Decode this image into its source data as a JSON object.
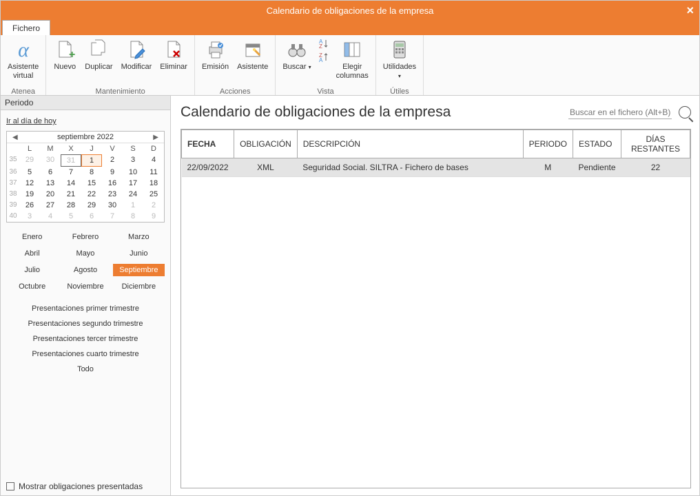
{
  "window": {
    "title": "Calendario de obligaciones de la empresa"
  },
  "tabs": {
    "fichero": "Fichero"
  },
  "ribbon": {
    "atenea": {
      "label": "Asistente\nvirtual",
      "group": "Atenea"
    },
    "mantenimiento": {
      "group": "Mantenimiento",
      "nuevo": "Nuevo",
      "duplicar": "Duplicar",
      "modificar": "Modificar",
      "eliminar": "Eliminar"
    },
    "acciones": {
      "group": "Acciones",
      "emision": "Emisión",
      "asistente": "Asistente"
    },
    "vista": {
      "group": "Vista",
      "buscar": "Buscar",
      "elegir": "Elegir\ncolumnas"
    },
    "utilidades": {
      "group": "Útiles",
      "util": "Utilidades"
    }
  },
  "sidebar": {
    "header": "Periodo",
    "today_link": "Ir al día de hoy",
    "cal_title": "septiembre  2022",
    "dow": [
      "L",
      "M",
      "X",
      "J",
      "V",
      "S",
      "D"
    ],
    "weeks": [
      {
        "wk": "35",
        "days": [
          {
            "d": "29",
            "o": true
          },
          {
            "d": "30",
            "o": true
          },
          {
            "d": "31",
            "o": true,
            "sel": true
          },
          {
            "d": "1",
            "today": true
          },
          {
            "d": "2"
          },
          {
            "d": "3"
          },
          {
            "d": "4"
          }
        ]
      },
      {
        "wk": "36",
        "days": [
          {
            "d": "5"
          },
          {
            "d": "6"
          },
          {
            "d": "7"
          },
          {
            "d": "8"
          },
          {
            "d": "9"
          },
          {
            "d": "10"
          },
          {
            "d": "11"
          }
        ]
      },
      {
        "wk": "37",
        "days": [
          {
            "d": "12"
          },
          {
            "d": "13"
          },
          {
            "d": "14"
          },
          {
            "d": "15"
          },
          {
            "d": "16"
          },
          {
            "d": "17"
          },
          {
            "d": "18"
          }
        ]
      },
      {
        "wk": "38",
        "days": [
          {
            "d": "19"
          },
          {
            "d": "20"
          },
          {
            "d": "21"
          },
          {
            "d": "22"
          },
          {
            "d": "23"
          },
          {
            "d": "24"
          },
          {
            "d": "25"
          }
        ]
      },
      {
        "wk": "39",
        "days": [
          {
            "d": "26"
          },
          {
            "d": "27"
          },
          {
            "d": "28"
          },
          {
            "d": "29"
          },
          {
            "d": "30"
          },
          {
            "d": "1",
            "o": true
          },
          {
            "d": "2",
            "o": true
          }
        ]
      },
      {
        "wk": "40",
        "days": [
          {
            "d": "3",
            "o": true
          },
          {
            "d": "4",
            "o": true
          },
          {
            "d": "5",
            "o": true
          },
          {
            "d": "6",
            "o": true
          },
          {
            "d": "7",
            "o": true
          },
          {
            "d": "8",
            "o": true
          },
          {
            "d": "9",
            "o": true
          }
        ]
      }
    ],
    "months": [
      "Enero",
      "Febrero",
      "Marzo",
      "Abril",
      "Mayo",
      "Junio",
      "Julio",
      "Agosto",
      "Septiembre",
      "Octubre",
      "Noviembre",
      "Diciembre"
    ],
    "active_month": 8,
    "presets": [
      "Presentaciones primer trimestre",
      "Presentaciones segundo trimestre",
      "Presentaciones tercer trimestre",
      "Presentaciones cuarto trimestre",
      "Todo"
    ],
    "checkbox": "Mostrar obligaciones presentadas"
  },
  "main": {
    "title": "Calendario de obligaciones de la empresa",
    "search_placeholder": "Buscar en el fichero (Alt+B)",
    "columns": {
      "fecha": "FECHA",
      "oblig": "OBLIGACIÓN",
      "desc": "DESCRIPCIÓN",
      "periodo": "PERIODO",
      "estado": "ESTADO",
      "dias": "DÍAS RESTANTES"
    },
    "rows": [
      {
        "fecha": "22/09/2022",
        "oblig": "XML",
        "desc": "Seguridad Social. SILTRA - Fichero de bases",
        "periodo": "M",
        "estado": "Pendiente",
        "dias": "22"
      }
    ]
  }
}
